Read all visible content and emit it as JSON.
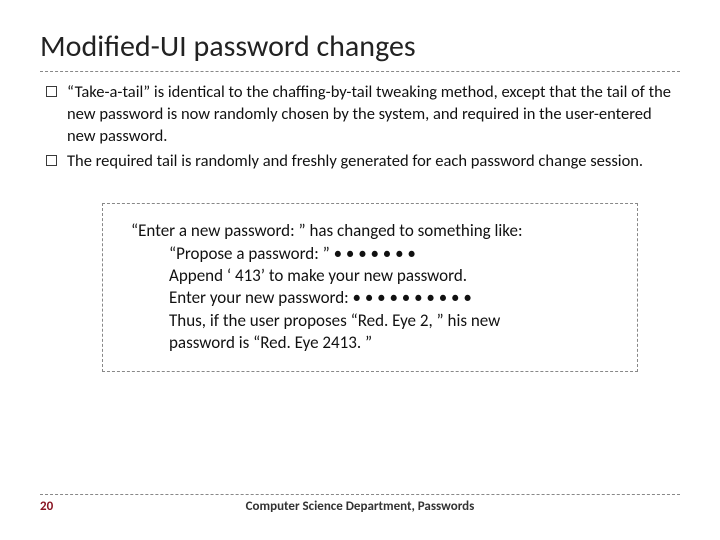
{
  "title": "Modified-UI password changes",
  "bullets": [
    "“Take-a-tail” is identical to the chaffing-by-tail tweaking method, except that the tail of the new password is now randomly chosen by the system, and required in the user-entered new password.",
    "The required tail is randomly and freshly generated for each password change session."
  ],
  "example": {
    "intro": "“Enter a new password: ” has changed to something like:",
    "lines": [
      "“Propose a password: ” • • • • • • •",
      "Append ‘ 413’ to make your new password.",
      "Enter your new password: • • • • • • • • • •",
      "Thus, if the user proposes “Red. Eye 2, ” his new",
      "password is “Red. Eye 2413. ”"
    ]
  },
  "footer": {
    "page": "20",
    "dept": "Computer Science Department, Passwords"
  }
}
